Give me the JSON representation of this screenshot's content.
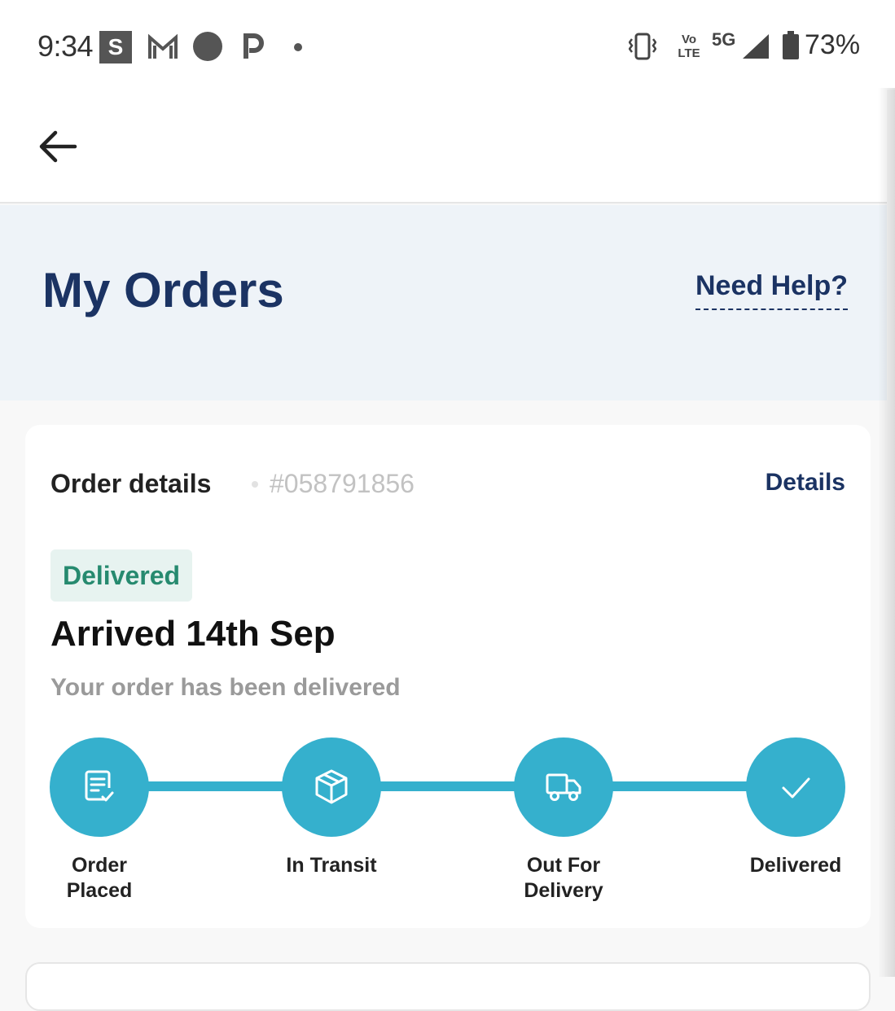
{
  "status_bar": {
    "time": "9:34",
    "notif_s": "S",
    "network": "5G",
    "volte_top": "Vo",
    "volte_bottom": "LTE",
    "battery": "73%"
  },
  "header": {
    "title": "My Orders",
    "help_link": "Need Help?"
  },
  "order": {
    "label": "Order details",
    "number": "#058791856",
    "details_link": "Details",
    "status_badge": "Delivered",
    "arrival": "Arrived 14th Sep",
    "message": "Your order has been delivered",
    "steps": [
      {
        "label": "Order\nPlaced",
        "icon": "order-placed-icon"
      },
      {
        "label": "In Transit",
        "icon": "package-icon"
      },
      {
        "label": "Out For\nDelivery",
        "icon": "truck-icon"
      },
      {
        "label": "Delivered",
        "icon": "checkmark-icon"
      }
    ]
  },
  "colors": {
    "primary": "#1b3363",
    "accent": "#35b0cd",
    "success": "#268a6f"
  }
}
